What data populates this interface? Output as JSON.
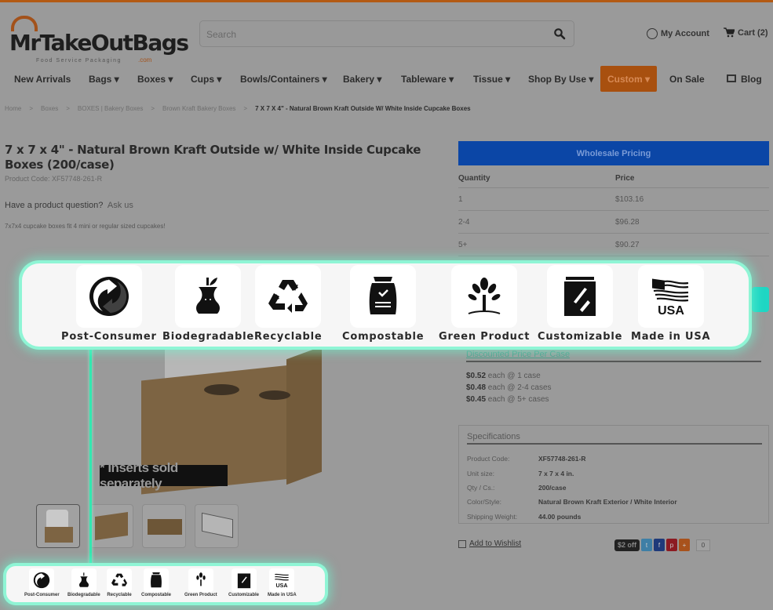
{
  "header": {
    "logo_text": "MrTakeOutBags",
    "logo_tagline": "Food Service Packaging",
    "logo_suffix": ".com",
    "search_placeholder": "Search",
    "account_label": "My Account",
    "cart_label": "Cart (2)"
  },
  "nav": {
    "items": [
      {
        "label": "New Arrivals"
      },
      {
        "label": "Bags ▾"
      },
      {
        "label": "Boxes ▾"
      },
      {
        "label": "Cups ▾"
      },
      {
        "label": "Bowls/Containers ▾"
      },
      {
        "label": "Bakery ▾"
      },
      {
        "label": "Tableware ▾"
      },
      {
        "label": "Tissue ▾"
      },
      {
        "label": "Shop By Use ▾"
      },
      {
        "label": "Custom ▾"
      },
      {
        "label": "On Sale"
      },
      {
        "label": "Blog"
      }
    ],
    "accent_color": "#a8500f"
  },
  "breadcrumb": {
    "items": [
      "Home",
      "Boxes",
      "BOXES | Bakery Boxes",
      "Brown Kraft Bakery Boxes"
    ],
    "separator": ">",
    "current": "7 X 7 X 4\" - Natural Brown Kraft Outside W/ White Inside Cupcake Boxes"
  },
  "product": {
    "title": "7 x 7 x 4\" - Natural Brown Kraft Outside w/ White Inside Cupcake Boxes (200/case)",
    "code_line": "Product Code: XF57748-261-R",
    "question": "Have a product question?",
    "ask_link": "Ask us",
    "description": "7x7x4 cupcake boxes fit 4 mini or regular sized cupcakes!",
    "image_note": "* Inserts sold separately"
  },
  "pricing": {
    "button_label": "Wholesale Pricing",
    "headers": [
      "Quantity",
      "Price"
    ],
    "rows": [
      {
        "qty": "1",
        "price": "$103.16"
      },
      {
        "qty": "2-4",
        "price": "$96.28"
      },
      {
        "qty": "5+",
        "price": "$90.27"
      }
    ],
    "brand_color": "#0b46a6"
  },
  "discount": {
    "heading": "Discounted Price Per Case",
    "lines": [
      {
        "price": "$0.52",
        "rest": " each @ 1 case"
      },
      {
        "price": "$0.48",
        "rest": " each @ 2-4 cases"
      },
      {
        "price": "$0.45",
        "rest": " each @ 5+ cases"
      }
    ]
  },
  "specs": {
    "heading": "Specifications",
    "rows": [
      {
        "k": "Product Code:",
        "v": "XF57748-261-R"
      },
      {
        "k": "Unit size:",
        "v": "7 x 7 x 4 in."
      },
      {
        "k": "Qty / Cs.:",
        "v": "200/case"
      },
      {
        "k": "Color/Style:",
        "v": "Natural Brown Kraft Exterior / White Interior"
      },
      {
        "k": "Shipping Weight:",
        "v": "44.00 pounds"
      }
    ]
  },
  "actions": {
    "wishlist": "Add to Wishlist",
    "discount_badge": "$2 off",
    "share_count": "0",
    "share_icons": [
      "twitter-icon",
      "facebook-icon",
      "pinterest-icon",
      "share-icon"
    ]
  },
  "badges": {
    "items": [
      {
        "label": "Post-Consumer",
        "icon": "green-dot-recycle-icon"
      },
      {
        "label": "Biodegradable",
        "icon": "apple-core-icon"
      },
      {
        "label": "Recyclable",
        "icon": "recycle-icon"
      },
      {
        "label": "Compostable",
        "icon": "compost-bag-icon"
      },
      {
        "label": "Green Product",
        "icon": "tree-icon"
      },
      {
        "label": "Customizable",
        "icon": "custom-bag-icon"
      },
      {
        "label": "Made in USA",
        "icon": "usa-flag-icon"
      }
    ],
    "usa_text": "USA",
    "highlight_color": "#8ff5d5"
  }
}
